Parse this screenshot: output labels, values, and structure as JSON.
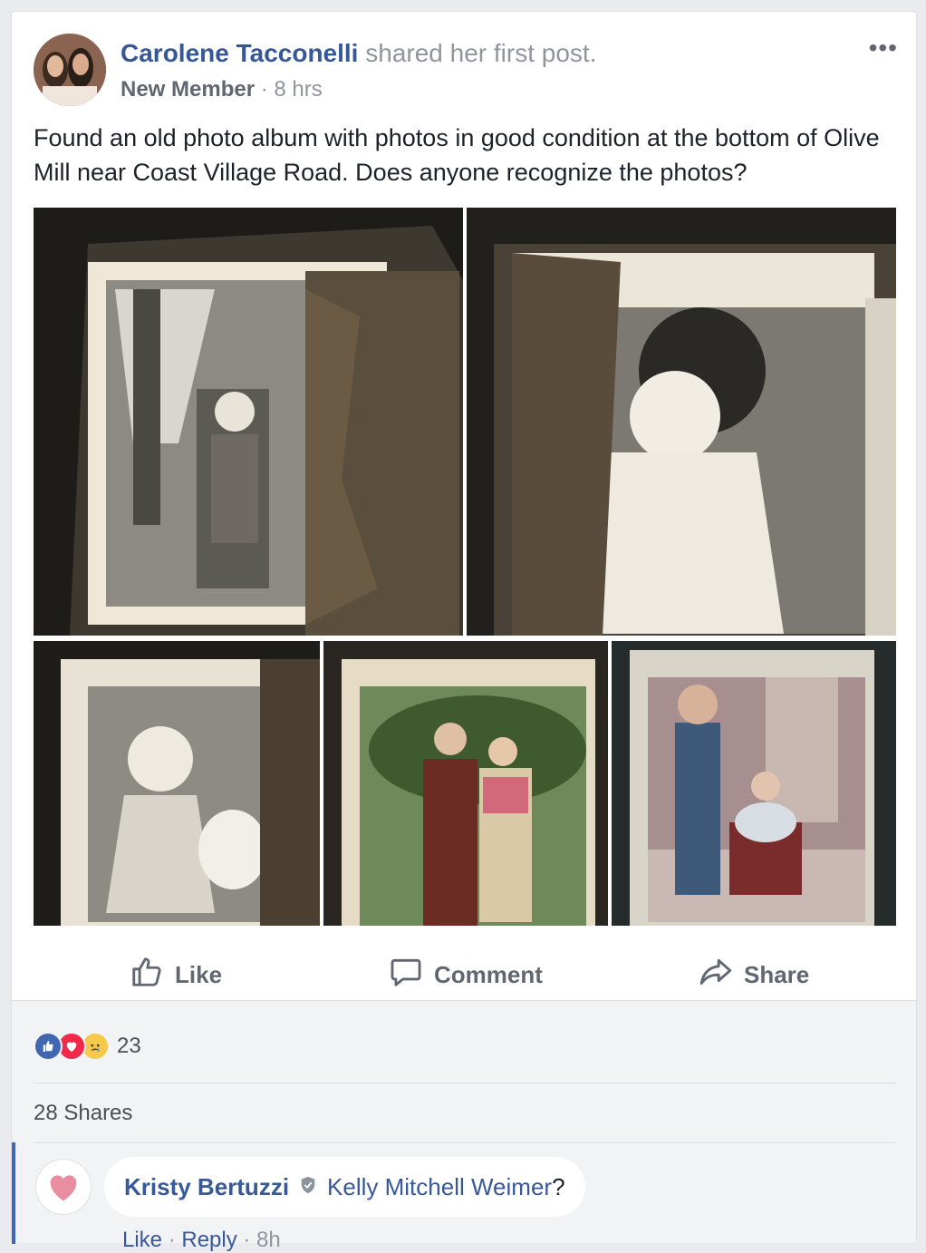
{
  "post": {
    "author": "Carolene Tacconelli",
    "action_text": "shared her first post.",
    "badge": "New Member",
    "separator": " · ",
    "time": "8 hrs",
    "more_label": "•••",
    "text": "Found an old photo album with photos in good condition at the bottom of Olive Mill near Coast Village Road. Does anyone recognize the photos?"
  },
  "actions": {
    "like": "Like",
    "comment": "Comment",
    "share": "Share"
  },
  "reactions": {
    "icons": [
      "like-icon",
      "love-icon",
      "sad-icon"
    ],
    "count": "23"
  },
  "shares": "28 Shares",
  "comment": {
    "author": "Kristy Bertuzzi",
    "mention": "Kelly Mitchell Weimer",
    "tail": "?",
    "like": "Like",
    "reply": "Reply",
    "sep": " · ",
    "time": "8h"
  },
  "colors": {
    "link": "#365899",
    "meta": "#90949c",
    "like_blue": "#4267b2",
    "love_red": "#f0284a"
  }
}
